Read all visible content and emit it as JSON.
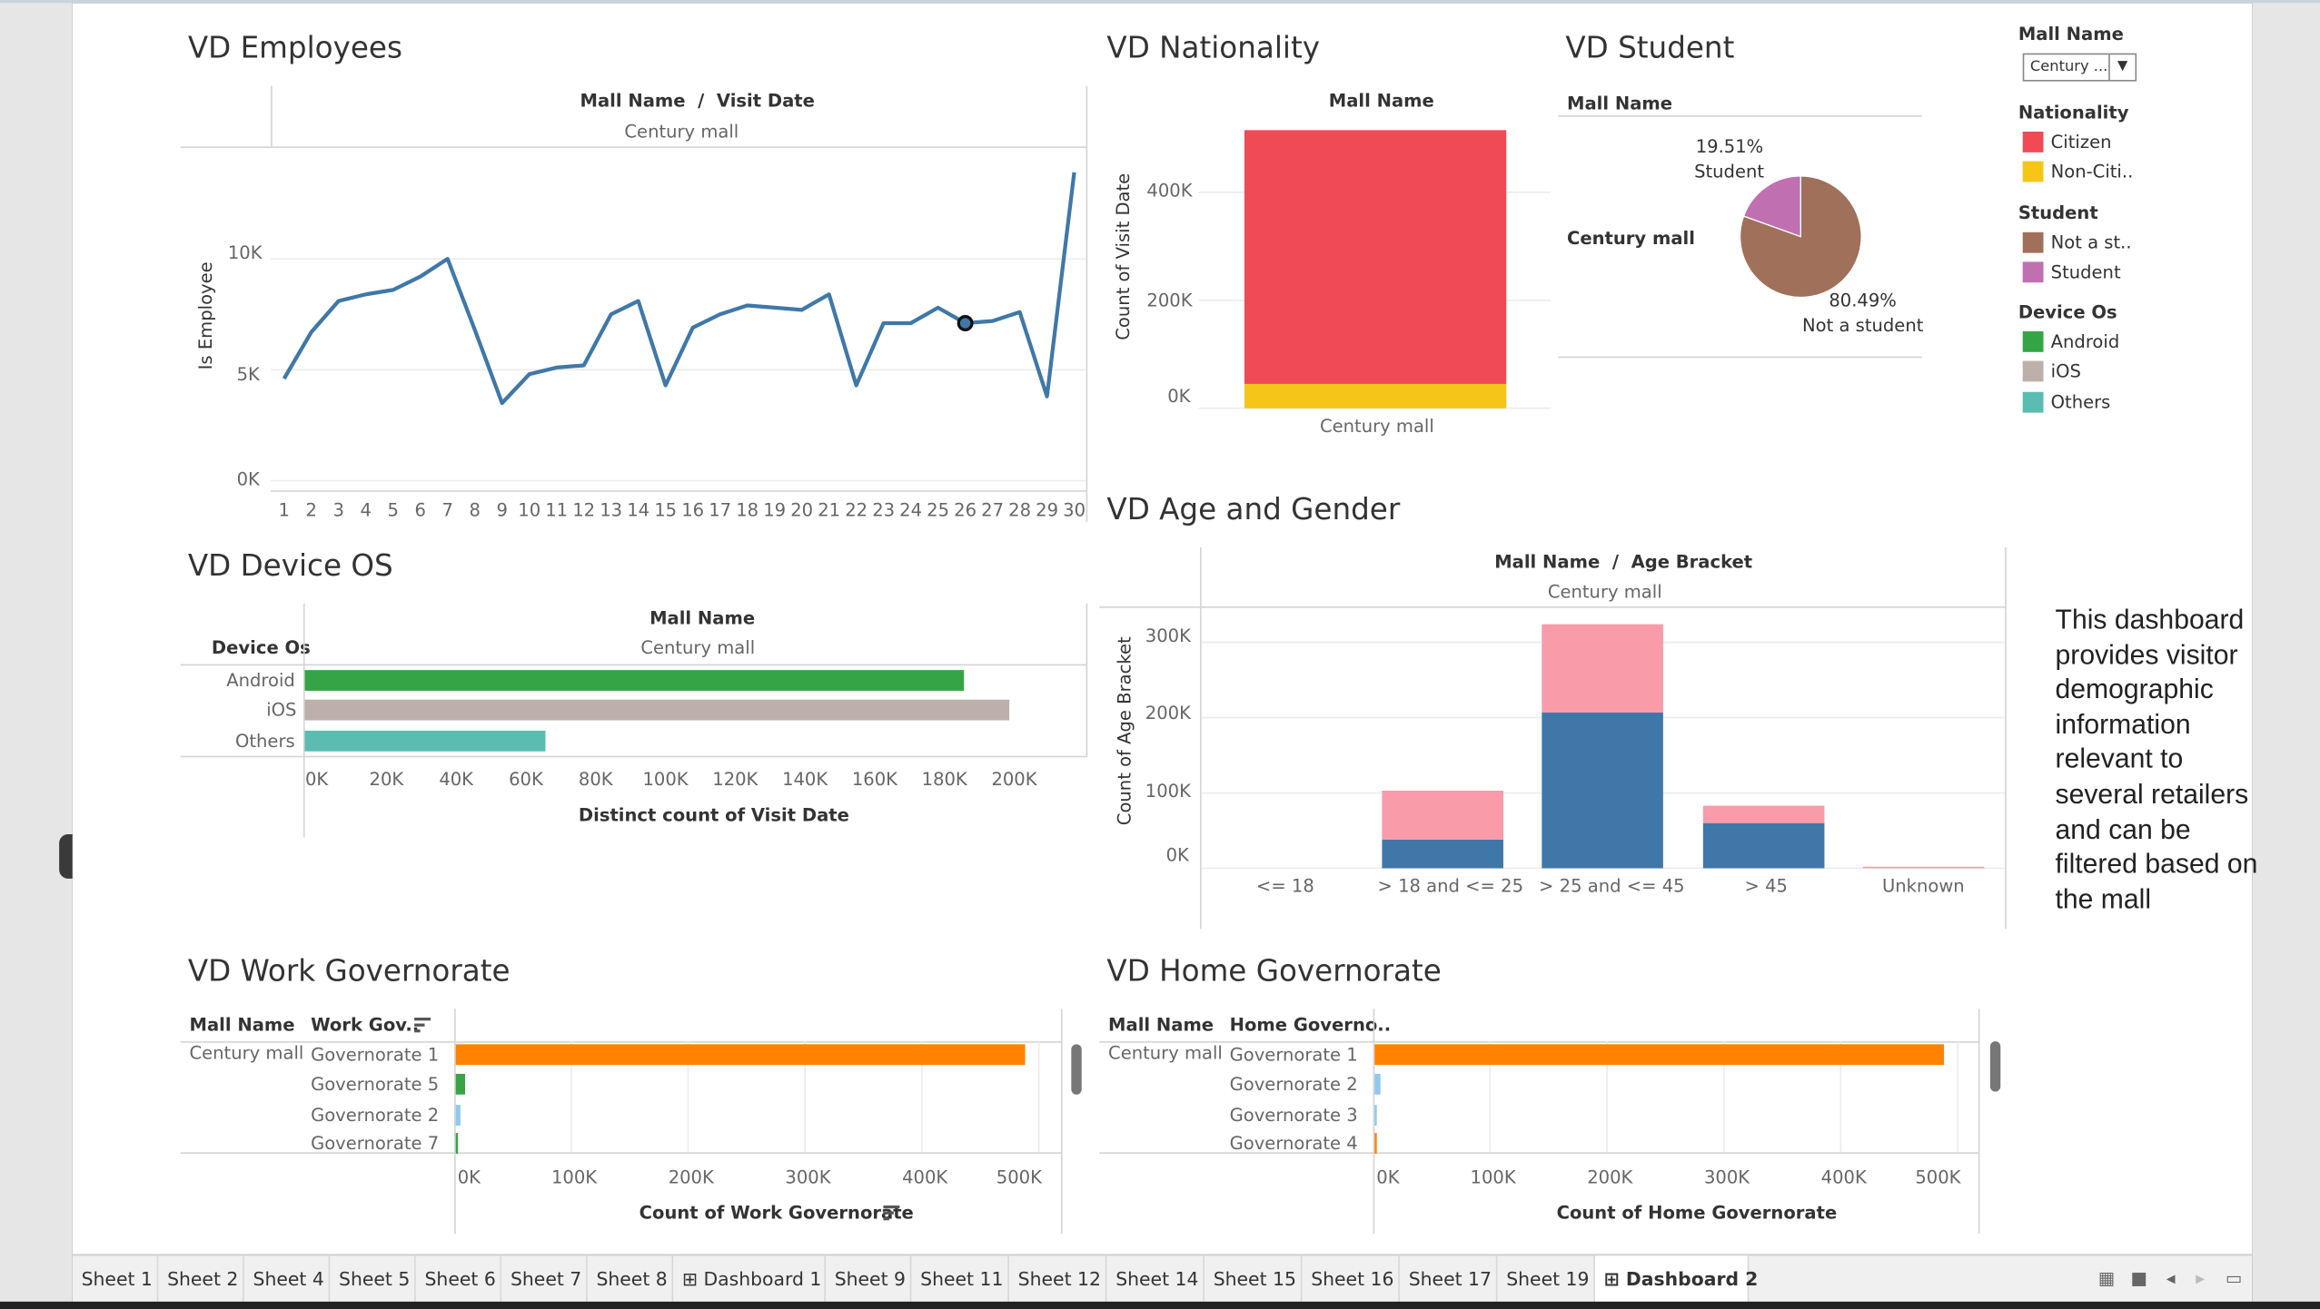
{
  "sheets": {
    "employees": {
      "title": "VD Employees",
      "header": "Mall Name  /  Visit Date",
      "sub": "Century mall",
      "ylabel": "Is Employee",
      "yticks": [
        "10K",
        "5K",
        "0K"
      ],
      "xticks": [
        "1",
        "2",
        "3",
        "4",
        "5",
        "6",
        "7",
        "8",
        "9",
        "10",
        "11",
        "12",
        "13",
        "14",
        "15",
        "16",
        "17",
        "18",
        "19",
        "20",
        "21",
        "22",
        "23",
        "24",
        "25",
        "26",
        "27",
        "28",
        "29",
        "30"
      ]
    },
    "nationality": {
      "title": "VD Nationality",
      "header": "Mall Name",
      "sub": "Century mall",
      "ylabel": "Count of Visit Date",
      "yticks": [
        "400K",
        "200K",
        "0K"
      ]
    },
    "student": {
      "title": "VD Student",
      "header": "Mall Name",
      "row_label": "Century mall",
      "label_student_pct": "19.51%",
      "label_student": "Student",
      "label_not_pct": "80.49%",
      "label_not": "Not a student"
    },
    "device": {
      "title": "VD Device OS",
      "header": "Mall Name",
      "sub": "Century mall",
      "row_header": "Device Os",
      "rows": [
        "Android",
        "iOS",
        "Others"
      ],
      "xticks": [
        "0K",
        "20K",
        "40K",
        "60K",
        "80K",
        "100K",
        "120K",
        "140K",
        "160K",
        "180K",
        "200K"
      ],
      "xlabel": "Distinct count of Visit Date"
    },
    "age": {
      "title": "VD Age and Gender",
      "header": "Mall Name  /  Age Bracket",
      "sub": "Century mall",
      "ylabel": "Count of Age Bracket",
      "yticks": [
        "300K",
        "200K",
        "100K",
        "0K"
      ],
      "categories": [
        "<= 18",
        "> 18 and <= 25",
        "> 25 and <= 45",
        "> 45",
        "Unknown"
      ]
    },
    "work": {
      "title": "VD Work Governorate",
      "col1": "Mall Name",
      "col2": "Work Gov..",
      "mall": "Century mall",
      "rows": [
        "Governorate 1",
        "Governorate 5",
        "Governorate 2",
        "Governorate 7"
      ],
      "xticks": [
        "0K",
        "100K",
        "200K",
        "300K",
        "400K",
        "500K"
      ],
      "xlabel": "Count of Work Governorate"
    },
    "home": {
      "title": "VD Home Governorate",
      "col1": "Mall Name",
      "col2": "Home Governo..",
      "mall": "Century mall",
      "rows": [
        "Governorate 1",
        "Governorate 2",
        "Governorate 3",
        "Governorate 4"
      ],
      "xticks": [
        "0K",
        "100K",
        "200K",
        "300K",
        "400K",
        "500K"
      ],
      "xlabel": "Count of Home Governorate"
    }
  },
  "filter": {
    "label": "Mall Name",
    "value": "Century ..."
  },
  "legends": {
    "nationality": {
      "title": "Nationality",
      "items": [
        "Citizen",
        "Non-Citi.."
      ]
    },
    "student": {
      "title": "Student",
      "items": [
        "Not a st..",
        "Student"
      ]
    },
    "device": {
      "title": "Device Os",
      "items": [
        "Android",
        "iOS",
        "Others"
      ]
    }
  },
  "colors": {
    "citizen": "#f04a54",
    "non_citizen": "#f5c518",
    "not_student": "#a0705a",
    "student": "#c070b0",
    "android": "#35a447",
    "ios": "#bdb0aa",
    "others": "#5bbcb2",
    "male": "#3f78a8",
    "female": "#f99ba8",
    "gov_orange": "#ff8300",
    "gov_green": "#3aa346",
    "gov_blue": "#8fc9ec",
    "line": "#3f78a8"
  },
  "note": "This dashboard provides visitor demographic information relevant to several retailers and can be filtered based on the mall",
  "tabs": [
    "Sheet 1",
    "Sheet 2",
    "Sheet 4",
    "Sheet 5",
    "Sheet 6",
    "Sheet 7",
    "Sheet 8",
    "Dashboard 1",
    "Sheet 9",
    "Sheet 11",
    "Sheet 12",
    "Sheet 14",
    "Sheet 15",
    "Sheet 16",
    "Sheet 17",
    "Sheet 19",
    "Dashboard 2"
  ],
  "active_tab": "Dashboard 2",
  "chart_data": [
    {
      "type": "line",
      "title": "VD Employees",
      "xlabel": "Visit Date",
      "ylabel": "Is Employee",
      "x": [
        1,
        2,
        3,
        4,
        5,
        6,
        7,
        8,
        9,
        10,
        11,
        12,
        13,
        14,
        15,
        16,
        17,
        18,
        19,
        20,
        21,
        22,
        23,
        24,
        25,
        26,
        27,
        28,
        29,
        30
      ],
      "values": [
        4600,
        6700,
        8100,
        8400,
        8600,
        9200,
        10000,
        6800,
        3500,
        4800,
        5100,
        5200,
        7500,
        8100,
        4300,
        6900,
        7500,
        7900,
        7800,
        7700,
        8400,
        4300,
        7100,
        7100,
        7800,
        7100,
        7200,
        7600,
        3800,
        13900
      ],
      "ylim": [
        0,
        14000
      ],
      "highlight_x": 26
    },
    {
      "type": "bar",
      "title": "VD Nationality",
      "categories": [
        "Century mall"
      ],
      "ylabel": "Count of Visit Date",
      "series": [
        {
          "name": "Non-Citi..",
          "values": [
            45000
          ]
        },
        {
          "name": "Citizen",
          "values": [
            470000
          ]
        }
      ],
      "ylim": [
        0,
        515000
      ]
    },
    {
      "type": "pie",
      "title": "VD Student",
      "series": [
        {
          "name": "Not a student",
          "values": [
            80.49
          ]
        },
        {
          "name": "Student",
          "values": [
            19.51
          ]
        }
      ]
    },
    {
      "type": "bar",
      "title": "VD Device OS",
      "categories": [
        "Android",
        "iOS",
        "Others"
      ],
      "values": [
        189000,
        202000,
        69000
      ],
      "xlabel": "Distinct count of Visit Date",
      "xlim": [
        0,
        210000
      ]
    },
    {
      "type": "bar",
      "title": "VD Age and Gender",
      "categories": [
        "<= 18",
        "> 18 and <= 25",
        "> 25 and <= 45",
        "> 45",
        "Unknown"
      ],
      "ylabel": "Count of Age Bracket",
      "series": [
        {
          "values": [
            0,
            38000,
            207000,
            60000,
            0
          ]
        },
        {
          "values": [
            0,
            65000,
            117000,
            23000,
            2000
          ]
        }
      ],
      "ylim": [
        0,
        330000
      ]
    },
    {
      "type": "bar",
      "title": "VD Work Governorate",
      "categories": [
        "Governorate 1",
        "Governorate 5",
        "Governorate 2",
        "Governorate 7"
      ],
      "values": [
        487000,
        8000,
        4000,
        1500
      ],
      "xlabel": "Count of Work Governorate",
      "xlim": [
        0,
        510000
      ]
    },
    {
      "type": "bar",
      "title": "VD Home Governorate",
      "categories": [
        "Governorate 1",
        "Governorate 2",
        "Governorate 3",
        "Governorate 4"
      ],
      "values": [
        487000,
        5000,
        500,
        1500
      ],
      "xlabel": "Count of Home Governorate",
      "xlim": [
        0,
        510000
      ]
    }
  ]
}
